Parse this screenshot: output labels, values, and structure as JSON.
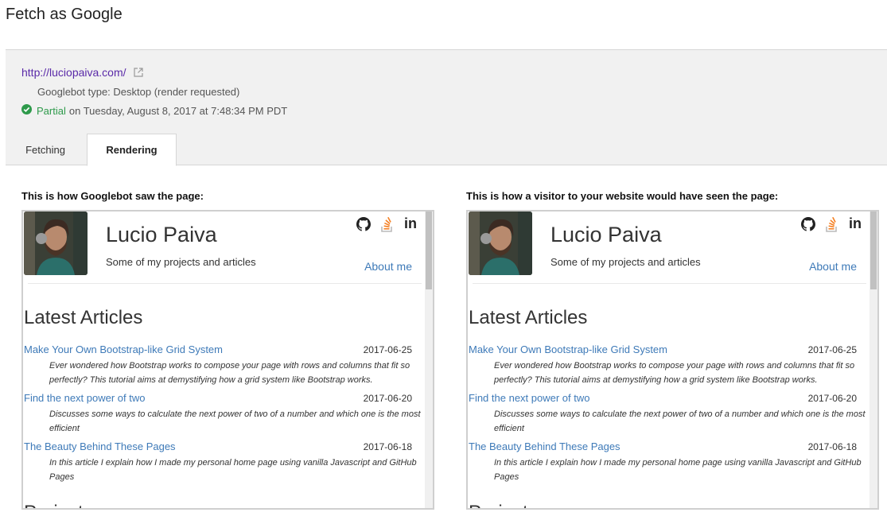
{
  "page": {
    "title": "Fetch as Google"
  },
  "fetch": {
    "url": "http://luciopaiva.com/",
    "googlebot_type": "Googlebot type: Desktop (render requested)",
    "status": "Partial",
    "status_rest": "on Tuesday, August 8, 2017 at 7:48:34 PM PDT"
  },
  "tabs": [
    {
      "label": "Fetching"
    },
    {
      "label": "Rendering"
    }
  ],
  "captions": {
    "googlebot": "This is how Googlebot saw the page:",
    "visitor": "This is how a visitor to your website would have seen the page:"
  },
  "site": {
    "name": "Lucio Paiva",
    "subtitle": "Some of my projects and articles",
    "about": "About me",
    "social_icons": [
      "github-icon",
      "stackoverflow-icon",
      "linkedin-icon"
    ],
    "section_title": "Latest Articles",
    "next_section_partial": "Projects",
    "articles": [
      {
        "title": "Make Your Own Bootstrap-like Grid System",
        "date": "2017-06-25",
        "desc_line1": "Ever wondered how Bootstrap works to compose your page with rows and columns that fit so",
        "desc_line2": "perfectly? This tutorial aims at demystifying how a grid system like Bootstrap works."
      },
      {
        "title": "Find the next power of two",
        "date": "2017-06-20",
        "desc_line1": "Discusses some ways to calculate the next power of two of a number and which one is the most",
        "desc_line2": "efficient"
      },
      {
        "title": "The Beauty Behind These Pages",
        "date": "2017-06-18",
        "desc_line1": "In this article I explain how I made my personal home page using vanilla Javascript and GitHub",
        "desc_line2": "Pages"
      }
    ]
  },
  "colors": {
    "link": "#3e7ab8",
    "visited_url": "#5a2aa8",
    "status_ok": "#2e9a4b"
  }
}
